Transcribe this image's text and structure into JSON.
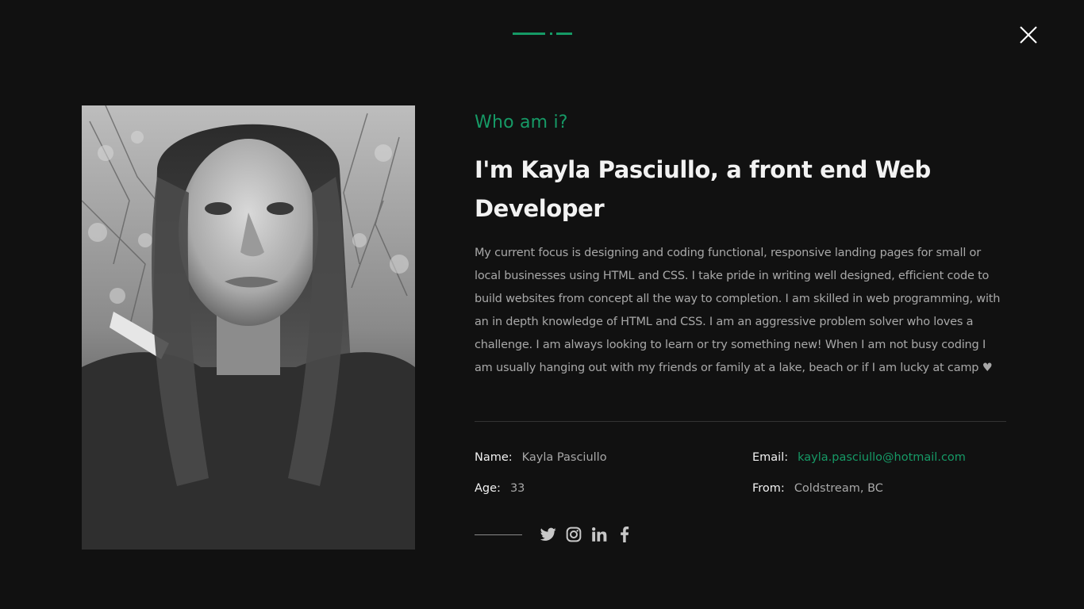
{
  "colors": {
    "background": "#111111",
    "accent": "#169a66",
    "heading": "#f2f2f2",
    "body_text": "#a8a8a8"
  },
  "header": {
    "close_icon": "close-icon"
  },
  "about": {
    "subtitle": "Who am i?",
    "headline": "I'm Kayla Pasciullo, a front end Web Developer",
    "bio": "My current focus is designing and coding functional, responsive landing pages for small or local businesses using HTML and CSS. I take pride in writing well designed, efficient code to build websites from concept all the way to completion. I am skilled in web programming, with an in depth knowledge of HTML and CSS. I am an aggressive problem solver who loves a challenge. I am always looking to learn or try something new! When I am not busy coding I am usually hanging out with my friends or family at a lake, beach or if I am lucky at camp ♥"
  },
  "details": {
    "name_label": "Name:",
    "name_value": "Kayla Pasciullo",
    "age_label": "Age:",
    "age_value": "33",
    "email_label": "Email:",
    "email_value": "kayla.pasciullo@hotmail.com",
    "from_label": "From:",
    "from_value": "Coldstream, BC"
  },
  "social": {
    "icons": [
      "twitter-icon",
      "instagram-icon",
      "linkedin-icon",
      "facebook-icon"
    ]
  }
}
